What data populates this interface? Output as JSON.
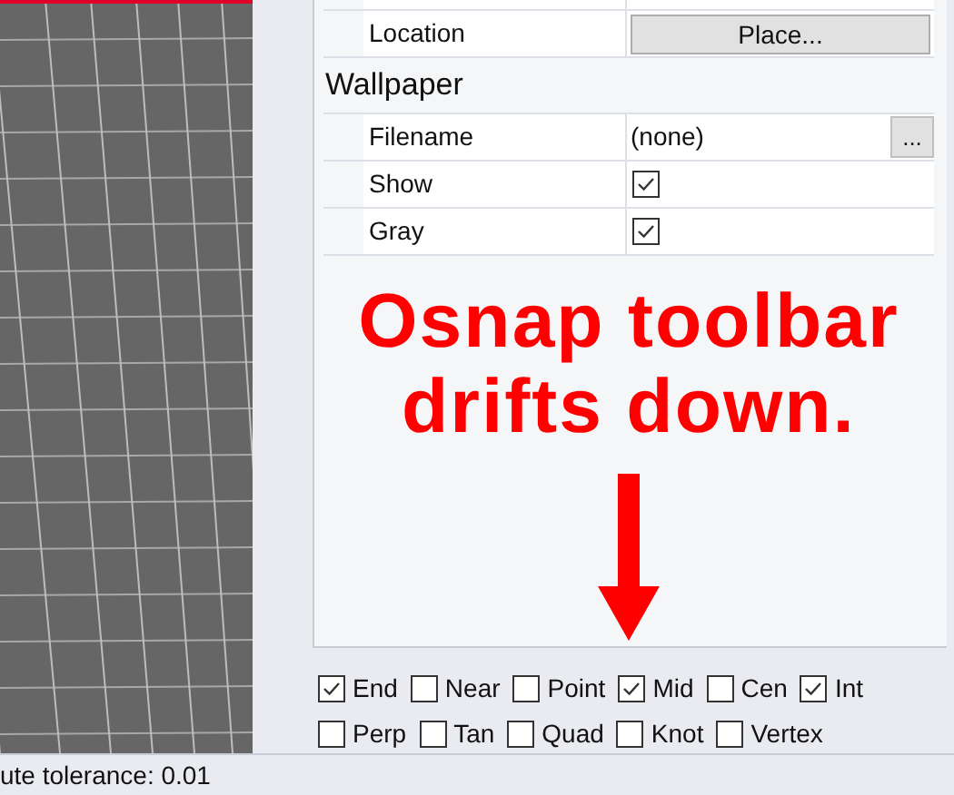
{
  "properties": {
    "rows": [
      {
        "kind": "button",
        "label": "Location",
        "value": "Place..."
      },
      {
        "kind": "section",
        "label": "Wallpaper"
      },
      {
        "kind": "file",
        "label": "Filename",
        "value": "(none)",
        "button": "..."
      },
      {
        "kind": "checkbox",
        "label": "Show",
        "checked": true
      },
      {
        "kind": "checkbox",
        "label": "Gray",
        "checked": true
      }
    ]
  },
  "annotation": {
    "lines": [
      "Osnap toolbar",
      "drifts down."
    ]
  },
  "osnap": {
    "rows": [
      [
        {
          "label": "End",
          "checked": true
        },
        {
          "label": "Near",
          "checked": false
        },
        {
          "label": "Point",
          "checked": false
        },
        {
          "label": "Mid",
          "checked": true
        },
        {
          "label": "Cen",
          "checked": false
        },
        {
          "label": "Int",
          "checked": true
        }
      ],
      [
        {
          "label": "Perp",
          "checked": false
        },
        {
          "label": "Tan",
          "checked": false
        },
        {
          "label": "Quad",
          "checked": false
        },
        {
          "label": "Knot",
          "checked": false
        },
        {
          "label": "Vertex",
          "checked": false
        }
      ]
    ]
  },
  "status_bar": {
    "text": "ute tolerance: 0.01"
  }
}
